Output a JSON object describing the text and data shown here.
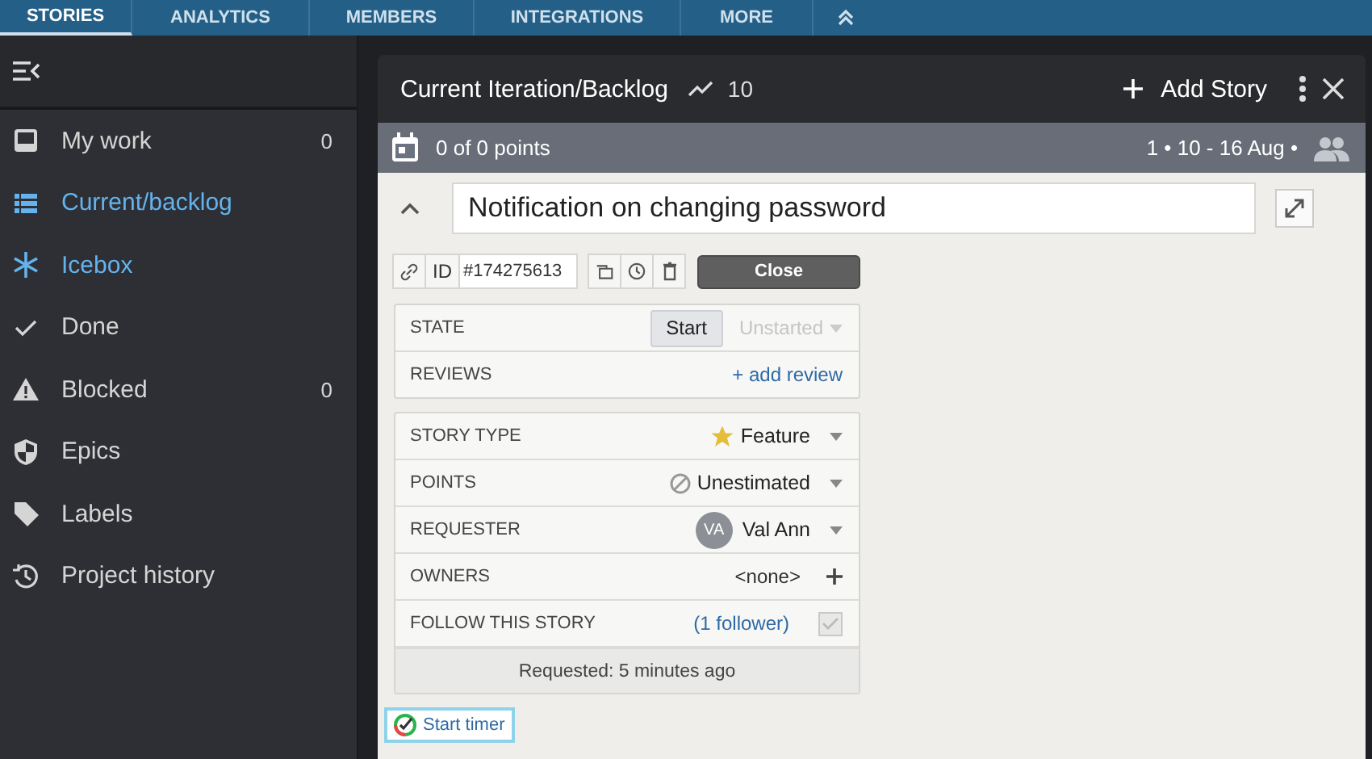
{
  "top_tabs": [
    {
      "label": "STORIES",
      "selected": true
    },
    {
      "label": "ANALYTICS",
      "selected": false
    },
    {
      "label": "MEMBERS",
      "selected": false
    },
    {
      "label": "INTEGRATIONS",
      "selected": false
    },
    {
      "label": "MORE",
      "selected": false
    }
  ],
  "sidebar": {
    "items": [
      {
        "label": "My work",
        "count": "0",
        "selected": false
      },
      {
        "label": "Current/backlog",
        "selected": true
      },
      {
        "label": "Icebox",
        "selected": true
      },
      {
        "label": "Done",
        "selected": false
      },
      {
        "label": "Blocked",
        "count": "0",
        "selected": false
      },
      {
        "label": "Epics",
        "selected": false
      },
      {
        "label": "Labels",
        "selected": false
      },
      {
        "label": "Project history",
        "selected": false
      }
    ]
  },
  "panel": {
    "title": "Current Iteration/Backlog",
    "velocity": "10",
    "add_label": "Add Story",
    "iteration": {
      "points": "0 of 0 points",
      "dates": "1 • 10 - 16 Aug •"
    },
    "story": {
      "title": "Notification on changing password",
      "id_label": "ID",
      "id": "#174275613",
      "close_label": "Close",
      "state_group": [
        {
          "kind": "state",
          "label": "STATE",
          "button": "Start",
          "value": "Unstarted"
        },
        {
          "kind": "link",
          "label": "REVIEWS",
          "value": "+ add review"
        }
      ],
      "fields": [
        {
          "kind": "select",
          "label": "STORY TYPE",
          "value": "Feature"
        },
        {
          "kind": "select",
          "label": "POINTS",
          "value": "Unestimated"
        },
        {
          "kind": "avatar",
          "label": "REQUESTER",
          "initials": "VA",
          "value": "Val Ann"
        },
        {
          "kind": "add",
          "label": "OWNERS",
          "value": "<none>"
        },
        {
          "kind": "follow",
          "label": "FOLLOW THIS STORY",
          "value": "(1 follower)",
          "checked": true
        }
      ],
      "requested": "Requested: 5 minutes ago",
      "timer_label": "Start timer"
    }
  }
}
